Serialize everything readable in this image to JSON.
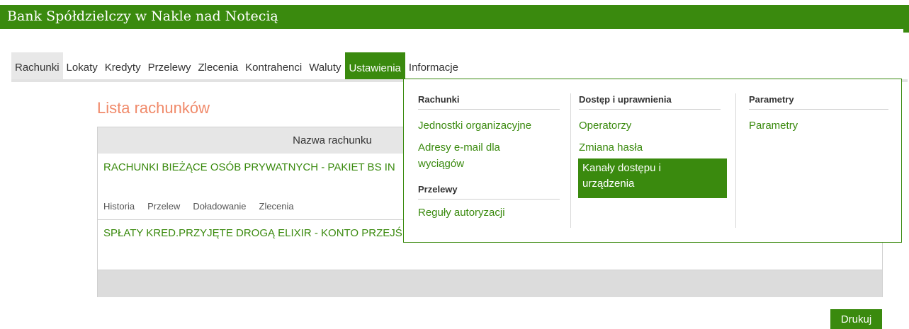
{
  "app": {
    "title": "Bank Spółdzielczy w Nakle nad Notecią"
  },
  "nav": {
    "tabs": [
      {
        "label": "Rachunki",
        "state": "current"
      },
      {
        "label": "Lokaty"
      },
      {
        "label": "Kredyty"
      },
      {
        "label": "Przelewy"
      },
      {
        "label": "Zlecenia"
      },
      {
        "label": "Kontrahenci"
      },
      {
        "label": "Waluty"
      },
      {
        "label": "Ustawienia",
        "state": "open"
      },
      {
        "label": "Informacje"
      }
    ]
  },
  "main": {
    "title": "Lista rachunków",
    "table": {
      "column_header": "Nazwa rachunku",
      "rows": [
        {
          "name": "RACHUNKI BIEŻĄCE OSÓB PRYWATNYCH - PAKIET BS IN",
          "actions": [
            "Historia",
            "Przelew",
            "Doładowanie",
            "Zlecenia"
          ]
        },
        {
          "name": "SPŁATY KRED.PRZYJĘTE DROGĄ ELIXIR - KONTO PRZEJŚ"
        }
      ]
    },
    "print_button": "Drukuj"
  },
  "menu": {
    "rachunki": {
      "header": "Rachunki",
      "items": [
        "Jednostki organizacyjne",
        "Adresy e-mail dla",
        "wyciągów"
      ]
    },
    "przelewy": {
      "header": "Przelewy",
      "items": [
        "Reguły autoryzacji"
      ]
    },
    "dostep": {
      "header": "Dostęp i uprawnienia",
      "items": [
        "Operatorzy",
        "Zmiana hasła"
      ],
      "highlighted": [
        "Kanały dostępu i",
        "urządzenia"
      ]
    },
    "parametry": {
      "header": "Parametry",
      "items": [
        "Parametry"
      ]
    }
  },
  "colors": {
    "brand": "#3a8a0e",
    "title_accent": "#f08a6a"
  }
}
